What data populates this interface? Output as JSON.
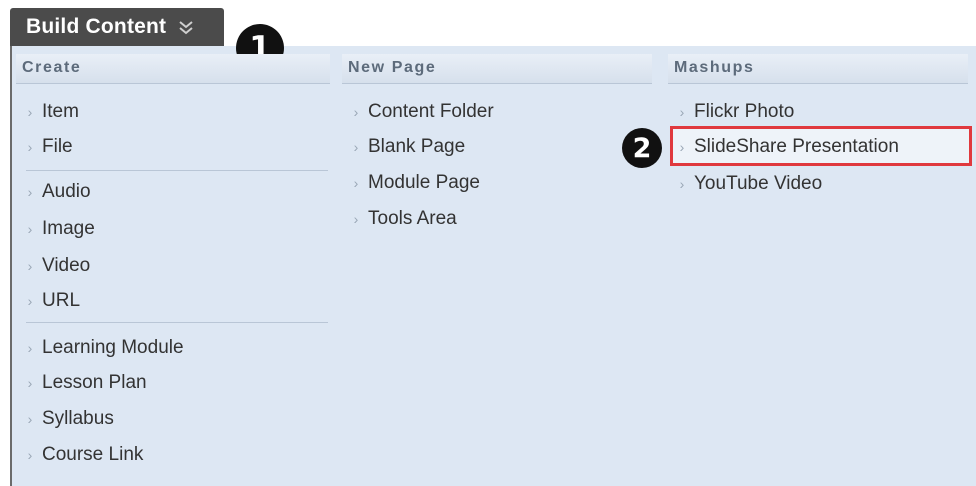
{
  "header": {
    "title": "Build Content",
    "menu_icon": "double-chevron-down-icon"
  },
  "callouts": [
    "1",
    "2"
  ],
  "columns": [
    {
      "heading": "Create",
      "groups": [
        [
          "Item",
          "File"
        ],
        [
          "Audio",
          "Image",
          "Video",
          "URL"
        ],
        [
          "Learning Module",
          "Lesson Plan",
          "Syllabus",
          "Course Link"
        ]
      ]
    },
    {
      "heading": "New Page",
      "items": [
        "Content Folder",
        "Blank Page",
        "Module Page",
        "Tools Area"
      ]
    },
    {
      "heading": "Mashups",
      "items": [
        "Flickr Photo",
        "SlideShare Presentation",
        "YouTube Video"
      ],
      "highlighted": "SlideShare Presentation"
    }
  ],
  "colors": {
    "tab_bg": "#4b4b4b",
    "panel_bg": "#dde7f3",
    "heading_text": "#5d6b7b",
    "highlight_border": "#e0393e"
  }
}
